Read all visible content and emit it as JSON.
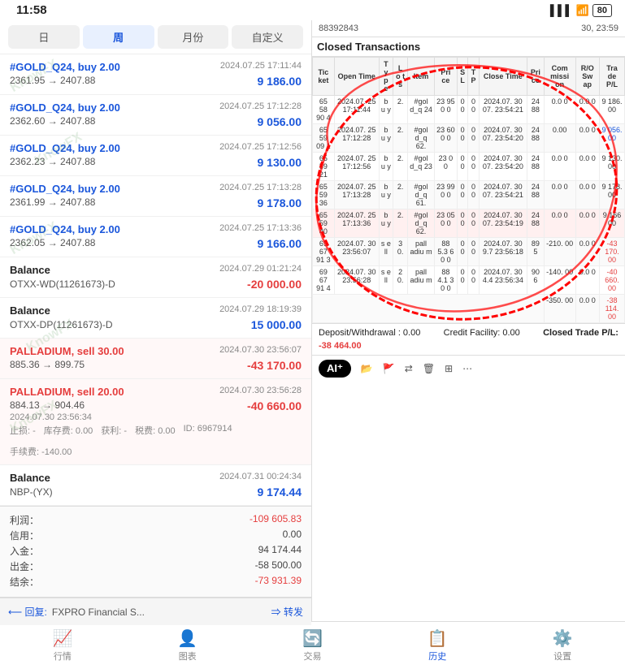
{
  "statusBar": {
    "time": "11:58",
    "signal": "▌▌▌",
    "wifi": "⚬",
    "battery": "80"
  },
  "tabs": {
    "items": [
      "日",
      "周",
      "月份",
      "自定义"
    ],
    "active": 1
  },
  "transactions": [
    {
      "id": 1,
      "title": "#GOLD_Q24, buy 2.00",
      "type": "buy",
      "date": "2024.07.25 17:11:44",
      "priceFrom": "2361.95",
      "priceTo": "2407.88",
      "amount": "9 186.00",
      "amountType": "positive"
    },
    {
      "id": 2,
      "title": "#GOLD_Q24, buy 2.00",
      "type": "buy",
      "date": "2024.07.25 17:12:28",
      "priceFrom": "2362.60",
      "priceTo": "2407.88",
      "amount": "9 056.00",
      "amountType": "positive"
    },
    {
      "id": 3,
      "title": "#GOLD_Q24, buy 2.00",
      "type": "buy",
      "date": "2024.07.25 17:12:56",
      "priceFrom": "2362.23",
      "priceTo": "2407.88",
      "amount": "9 130.00",
      "amountType": "positive"
    },
    {
      "id": 4,
      "title": "#GOLD_Q24, buy 2.00",
      "type": "buy",
      "date": "2024.07.25 17:13:28",
      "priceFrom": "2361.99",
      "priceTo": "2407.88",
      "amount": "9 178.00",
      "amountType": "positive"
    },
    {
      "id": 5,
      "title": "#GOLD_Q24, buy 2.00",
      "type": "buy",
      "date": "2024.07.25 17:13:36",
      "priceFrom": "2362.05",
      "priceTo": "2407.88",
      "amount": "9 166.00",
      "amountType": "positive"
    },
    {
      "id": 6,
      "title": "Balance",
      "subTitle": "OTXX-WD(11261673)-D",
      "type": "balance",
      "date": "2024.07.29 01:21:24",
      "amount": "-20 000.00",
      "amountType": "negative"
    },
    {
      "id": 7,
      "title": "Balance",
      "subTitle": "OTXX-DP(11261673)-D",
      "type": "balance",
      "date": "2024.07.29 18:19:39",
      "amount": "15 000.00",
      "amountType": "positive"
    },
    {
      "id": 8,
      "title": "PALLADIUM, sell 30.00",
      "type": "sell",
      "date": "2024.07.30 23:56:07",
      "priceFrom": "885.36",
      "priceTo": "899.75",
      "amount": "-43 170.00",
      "amountType": "negative"
    },
    {
      "id": 9,
      "title": "PALLADIUM, sell 20.00",
      "type": "sell",
      "date": "2024.07.30 23:56:28",
      "priceFrom": "884.13",
      "priceTo": "904.46",
      "amount": "-40 660.00",
      "amountType": "negative",
      "extraDate": "2024.07.30 23:56:34",
      "extraFields": [
        {
          "label": "止损:",
          "value": "-"
        },
        {
          "label": "库存费:",
          "value": "0.00"
        },
        {
          "label": "获利:",
          "value": "-"
        },
        {
          "label": "税费:",
          "value": "0.00"
        },
        {
          "label": "ID:",
          "value": "6967914"
        },
        {
          "label": "手续费:",
          "value": "-140.00"
        }
      ]
    },
    {
      "id": 10,
      "title": "Balance",
      "subTitle": "NBP-(YX)",
      "type": "balance",
      "date": "2024.07.31 00:24:34",
      "amount": "9 174.44",
      "amountType": "positive"
    }
  ],
  "summary": {
    "profit_label": "利润：",
    "profit": "-109 605.83",
    "credit_label": "信用：",
    "credit": "0.00",
    "deposit_label": "入金：",
    "deposit": "94 174.44",
    "withdrawal_label": "出金：",
    "withdrawal": "-58 500.00",
    "balance_label": "结余：",
    "balance": "-73 931.39"
  },
  "messageBar": {
    "replyLabel": "⟵ 回复:",
    "text": "FXPRO Financial S...",
    "forwardLabel": "⇒ 转发"
  },
  "bottomNav": [
    {
      "icon": "📈",
      "label": "行情"
    },
    {
      "icon": "👤",
      "label": "图表"
    },
    {
      "icon": "🔄",
      "label": "交易"
    },
    {
      "icon": "📋",
      "label": "历史",
      "active": true
    },
    {
      "icon": "⚙️",
      "label": "设置"
    }
  ],
  "rightPanel": {
    "headerLeft": "88392843",
    "headerRight": "30, 23:59",
    "sectionTitle": "Closed Transactions",
    "tableHeaders": [
      "Ticket",
      "Open Time",
      "Ty pe",
      "Lo ts",
      "Item",
      "Pri ce",
      "S L",
      "T P",
      "Close Time",
      "Pri ce",
      "Com missi on",
      "R/O Sw ap",
      "Tra de P/L"
    ],
    "tableRows": [
      [
        "65 58 90 4",
        "2024.07. 25 17:11:44",
        "b u y",
        "2.",
        "#gol d_q 24",
        "23 95 0 0",
        "0 0",
        "0 0",
        "2024.07. 30 07. 23:54:21",
        "24 88",
        "0.0 0",
        "0.0 0",
        "9 186. 00"
      ],
      [
        "65 59 09 1",
        "2024.07. 25 17:12:28",
        "b u y",
        "2.",
        "#gol d_q 62.",
        "23 60 0 0",
        "0 0",
        "0 0",
        "2024.07. 30 07. 23:54:20",
        "24 88",
        "0.00",
        "0.0 0",
        "9 056. 00"
      ],
      [
        "65 59 21",
        "2024.07. 25 17:12:56",
        "b u y",
        "2.",
        "#gol d_q 23",
        "23 0 0",
        "0 0",
        "0 0",
        "2024.07. 30 07. 23:54:20",
        "24 88",
        "0.0 0",
        "0.0 0",
        "9 130. 00"
      ],
      [
        "65 59 36",
        "2024.07. 25 17:13:28",
        "b u y",
        "2.",
        "#gol d_q 61.",
        "23 99 0 0",
        "0 0",
        "0 0",
        "2024.07. 30 07. 23:54:21",
        "24 88",
        "0.0 0",
        "0.0 0",
        "9 178. 00"
      ],
      [
        "65 59 40",
        "2024.07. 25 17:13:36",
        "b u y",
        "2.",
        "#gol d_q 62.",
        "23 05 0 0",
        "0 0",
        "0 0",
        "2024.07. 30 07. 23:54:19",
        "24 88",
        "0.0 0",
        "0.0 0",
        "9 166 00"
      ],
      [
        "69 67 91 3",
        "2024.07. 30 23:56:07",
        "s e ll",
        "3 0.",
        "pall adiu m",
        "88 5.3 6 0 0",
        "0 0",
        "0 0",
        "2024.07. 30 9.7 23:56:18",
        "89 5",
        "-210. 00",
        "0.0 0",
        "-43 170. 00"
      ],
      [
        "69 67 91 4",
        "2024.07. 30 23:56:28",
        "s e ll",
        "2 0.",
        "pall adiu m",
        "88 4.1 3 0 0",
        "0 0",
        "0 0",
        "2024.07. 30 4.4 23:56:34",
        "90 6",
        "-140. 00",
        "0.0 0",
        "-40 660. 00"
      ],
      [
        "",
        "",
        "",
        "",
        "",
        "",
        "",
        "",
        "",
        "",
        "-350. 00",
        "0.0 0",
        "-38 114. 00"
      ]
    ],
    "depositRow": {
      "depositLabel": "Deposit/Withdrawal : 0.00",
      "creditLabel": "Credit Facility: 0.00",
      "tradeLabel": "Closed Trade P/L:",
      "tradeValue": "-38 464.00"
    },
    "aiToolbar": {
      "aiLabel": "AI⁺",
      "icons": [
        "📂",
        "🚩",
        "⇄",
        "🗑",
        "⊞",
        "⋯"
      ]
    }
  }
}
